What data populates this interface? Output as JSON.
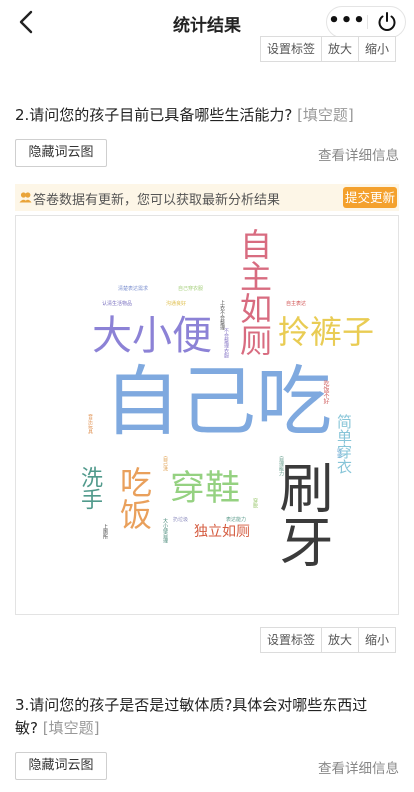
{
  "nav": {
    "title": "统计结果",
    "back_icon": "chevron-left-icon",
    "more_icon": "more-dots-icon",
    "power_icon": "power-icon"
  },
  "toolbar_labels": {
    "set_tag": "设置标签",
    "zoom_in": "放大",
    "zoom_out": "缩小"
  },
  "question2": {
    "title": "2.请问您的孩子目前已具备哪些生活能力?",
    "tag": "[填空题]",
    "hide_cloud": "隐藏词云图",
    "view_detail": "查看详细信息"
  },
  "notice": {
    "text": "答卷数据有更新，您可以获取最新分析结果",
    "submit": "提交更新",
    "accent": "#f4a12d"
  },
  "word_cloud": [
    {
      "text": "自己吃",
      "color": "#7fa9df"
    },
    {
      "text": "刷牙",
      "color": "#3b3b3b"
    },
    {
      "text": "大小便",
      "color": "#8c82d6"
    },
    {
      "text": "自主如厕",
      "color": "#d86c80"
    },
    {
      "text": "拎裤子",
      "color": "#e9cc54"
    },
    {
      "text": "穿鞋",
      "color": "#95d181"
    },
    {
      "text": "吃饭",
      "color": "#e9a05c"
    },
    {
      "text": "洗手",
      "color": "#519a8c"
    },
    {
      "text": "简单穿衣",
      "color": "#87c5d8"
    },
    {
      "text": "独立如厕",
      "color": "#d45a3e"
    },
    {
      "text": "清楚表达需求",
      "color": "#7b8fcf"
    },
    {
      "text": "自己穿衣服",
      "color": "#a6d07c"
    },
    {
      "text": "认清生活物品",
      "color": "#7a70c0"
    },
    {
      "text": "沟通良好",
      "color": "#e0c050"
    },
    {
      "text": "上衣不会整理",
      "color": "#555555"
    },
    {
      "text": "自主表达",
      "color": "#d05050"
    },
    {
      "text": "不会整理衣服",
      "color": "#8a7ac8"
    },
    {
      "text": "表达能力",
      "color": "#5a9a8a"
    },
    {
      "text": "音乐玩具",
      "color": "#e09050"
    },
    {
      "text": "吃饭不好",
      "color": "#d06060"
    },
    {
      "text": "穿脱",
      "color": "#9cc870"
    },
    {
      "text": "收拾",
      "color": "#7ab0d8"
    },
    {
      "text": "自己洗",
      "color": "#e0a050"
    },
    {
      "text": "扔垃圾",
      "color": "#9090c0"
    },
    {
      "text": "大小便自理",
      "color": "#4a8a7a"
    },
    {
      "text": "自理能力",
      "color": "#6aa090"
    },
    {
      "text": "上厕所",
      "color": "#444444"
    }
  ],
  "question3": {
    "title_line1": "3.请问您的孩子是否是过敏体质?具体会对哪些东西过",
    "title_line2": "敏?",
    "tag": "[填空题]",
    "hide_cloud": "隐藏词云图",
    "view_detail": "查看详细信息"
  }
}
